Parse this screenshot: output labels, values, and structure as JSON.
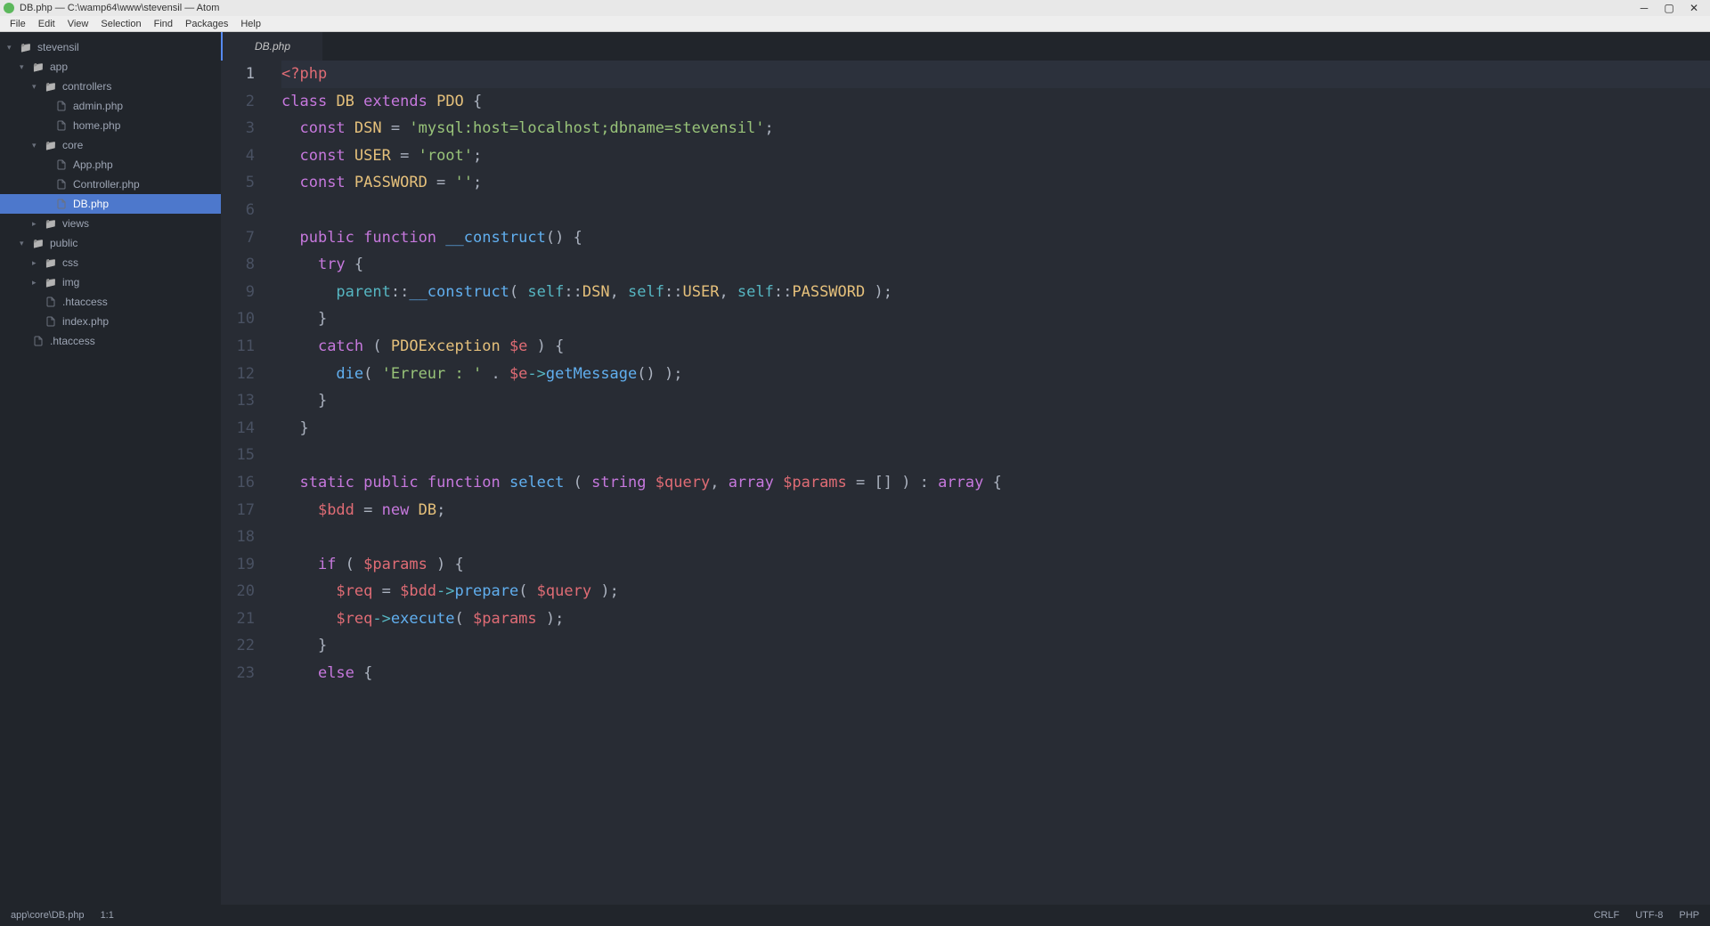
{
  "window": {
    "title": "DB.php — C:\\wamp64\\www\\stevensil — Atom"
  },
  "menu": {
    "items": [
      "File",
      "Edit",
      "View",
      "Selection",
      "Find",
      "Packages",
      "Help"
    ]
  },
  "sidebar": {
    "items": [
      {
        "label": "stevensil",
        "indent": 8,
        "type": "folder",
        "toggle": "▾"
      },
      {
        "label": "app",
        "indent": 22,
        "type": "folder",
        "toggle": "▾"
      },
      {
        "label": "controllers",
        "indent": 36,
        "type": "folder",
        "toggle": "▾"
      },
      {
        "label": "admin.php",
        "indent": 62,
        "type": "file"
      },
      {
        "label": "home.php",
        "indent": 62,
        "type": "file"
      },
      {
        "label": "core",
        "indent": 36,
        "type": "folder",
        "toggle": "▾"
      },
      {
        "label": "App.php",
        "indent": 62,
        "type": "file"
      },
      {
        "label": "Controller.php",
        "indent": 62,
        "type": "file"
      },
      {
        "label": "DB.php",
        "indent": 62,
        "type": "file",
        "selected": true
      },
      {
        "label": "views",
        "indent": 36,
        "type": "folder",
        "toggle": "▸"
      },
      {
        "label": "public",
        "indent": 22,
        "type": "folder",
        "toggle": "▾"
      },
      {
        "label": "css",
        "indent": 36,
        "type": "folder",
        "toggle": "▸"
      },
      {
        "label": "img",
        "indent": 36,
        "type": "folder",
        "toggle": "▸"
      },
      {
        "label": ".htaccess",
        "indent": 50,
        "type": "file"
      },
      {
        "label": "index.php",
        "indent": 50,
        "type": "file"
      },
      {
        "label": ".htaccess",
        "indent": 36,
        "type": "file"
      }
    ]
  },
  "tabs": {
    "active": "DB.php"
  },
  "editor": {
    "cursor": "1:1",
    "lines": [
      {
        "n": 1,
        "active": true,
        "tokens": [
          [
            "tag",
            "<?php"
          ]
        ]
      },
      {
        "n": 2,
        "tokens": [
          [
            "kw",
            "class"
          ],
          [
            "punc",
            " "
          ],
          [
            "cls",
            "DB"
          ],
          [
            "punc",
            " "
          ],
          [
            "kw",
            "extends"
          ],
          [
            "punc",
            " "
          ],
          [
            "cls",
            "PDO"
          ],
          [
            "punc",
            " {"
          ]
        ]
      },
      {
        "n": 3,
        "tokens": [
          [
            "punc",
            "  "
          ],
          [
            "kw",
            "const"
          ],
          [
            "punc",
            " "
          ],
          [
            "const-name",
            "DSN"
          ],
          [
            "punc",
            " = "
          ],
          [
            "str",
            "'mysql:host=localhost;dbname=stevensil'"
          ],
          [
            "punc",
            ";"
          ]
        ]
      },
      {
        "n": 4,
        "tokens": [
          [
            "punc",
            "  "
          ],
          [
            "kw",
            "const"
          ],
          [
            "punc",
            " "
          ],
          [
            "const-name",
            "USER"
          ],
          [
            "punc",
            " = "
          ],
          [
            "str",
            "'root'"
          ],
          [
            "punc",
            ";"
          ]
        ]
      },
      {
        "n": 5,
        "tokens": [
          [
            "punc",
            "  "
          ],
          [
            "kw",
            "const"
          ],
          [
            "punc",
            " "
          ],
          [
            "const-name",
            "PASSWORD"
          ],
          [
            "punc",
            " = "
          ],
          [
            "str",
            "''"
          ],
          [
            "punc",
            ";"
          ]
        ]
      },
      {
        "n": 6,
        "tokens": []
      },
      {
        "n": 7,
        "tokens": [
          [
            "punc",
            "  "
          ],
          [
            "kw",
            "public"
          ],
          [
            "punc",
            " "
          ],
          [
            "kw",
            "function"
          ],
          [
            "punc",
            " "
          ],
          [
            "fn",
            "__construct"
          ],
          [
            "punc",
            "() {"
          ]
        ]
      },
      {
        "n": 8,
        "tokens": [
          [
            "punc",
            "    "
          ],
          [
            "kw",
            "try"
          ],
          [
            "punc",
            " {"
          ]
        ]
      },
      {
        "n": 9,
        "tokens": [
          [
            "punc",
            "      "
          ],
          [
            "builtin",
            "parent"
          ],
          [
            "punc",
            "::"
          ],
          [
            "fn",
            "__construct"
          ],
          [
            "punc",
            "( "
          ],
          [
            "builtin",
            "self"
          ],
          [
            "punc",
            "::"
          ],
          [
            "const-name",
            "DSN"
          ],
          [
            "punc",
            ", "
          ],
          [
            "builtin",
            "self"
          ],
          [
            "punc",
            "::"
          ],
          [
            "const-name",
            "USER"
          ],
          [
            "punc",
            ", "
          ],
          [
            "builtin",
            "self"
          ],
          [
            "punc",
            "::"
          ],
          [
            "const-name",
            "PASSWORD"
          ],
          [
            "punc",
            " );"
          ]
        ]
      },
      {
        "n": 10,
        "tokens": [
          [
            "punc",
            "    }"
          ]
        ]
      },
      {
        "n": 11,
        "tokens": [
          [
            "punc",
            "    "
          ],
          [
            "kw",
            "catch"
          ],
          [
            "punc",
            " ( "
          ],
          [
            "cls",
            "PDOException"
          ],
          [
            "punc",
            " "
          ],
          [
            "var",
            "$e"
          ],
          [
            "punc",
            " ) {"
          ]
        ]
      },
      {
        "n": 12,
        "tokens": [
          [
            "punc",
            "      "
          ],
          [
            "fn",
            "die"
          ],
          [
            "punc",
            "( "
          ],
          [
            "str",
            "'Erreur : '"
          ],
          [
            "punc",
            " . "
          ],
          [
            "var",
            "$e"
          ],
          [
            "op",
            "->"
          ],
          [
            "fn",
            "getMessage"
          ],
          [
            "punc",
            "() );"
          ]
        ]
      },
      {
        "n": 13,
        "tokens": [
          [
            "punc",
            "    }"
          ]
        ]
      },
      {
        "n": 14,
        "tokens": [
          [
            "punc",
            "  }"
          ]
        ]
      },
      {
        "n": 15,
        "tokens": []
      },
      {
        "n": 16,
        "tokens": [
          [
            "punc",
            "  "
          ],
          [
            "kw",
            "static"
          ],
          [
            "punc",
            " "
          ],
          [
            "kw",
            "public"
          ],
          [
            "punc",
            " "
          ],
          [
            "kw",
            "function"
          ],
          [
            "punc",
            " "
          ],
          [
            "fn",
            "select"
          ],
          [
            "punc",
            " ( "
          ],
          [
            "kw",
            "string"
          ],
          [
            "punc",
            " "
          ],
          [
            "var",
            "$query"
          ],
          [
            "punc",
            ", "
          ],
          [
            "kw",
            "array"
          ],
          [
            "punc",
            " "
          ],
          [
            "var",
            "$params"
          ],
          [
            "punc",
            " = [] ) : "
          ],
          [
            "kw",
            "array"
          ],
          [
            "punc",
            " {"
          ]
        ]
      },
      {
        "n": 17,
        "tokens": [
          [
            "punc",
            "    "
          ],
          [
            "var",
            "$bdd"
          ],
          [
            "punc",
            " = "
          ],
          [
            "kw",
            "new"
          ],
          [
            "punc",
            " "
          ],
          [
            "cls",
            "DB"
          ],
          [
            "punc",
            ";"
          ]
        ]
      },
      {
        "n": 18,
        "tokens": []
      },
      {
        "n": 19,
        "tokens": [
          [
            "punc",
            "    "
          ],
          [
            "kw",
            "if"
          ],
          [
            "punc",
            " ( "
          ],
          [
            "var",
            "$params"
          ],
          [
            "punc",
            " ) {"
          ]
        ]
      },
      {
        "n": 20,
        "tokens": [
          [
            "punc",
            "      "
          ],
          [
            "var",
            "$req"
          ],
          [
            "punc",
            " = "
          ],
          [
            "var",
            "$bdd"
          ],
          [
            "op",
            "->"
          ],
          [
            "fn",
            "prepare"
          ],
          [
            "punc",
            "( "
          ],
          [
            "var",
            "$query"
          ],
          [
            "punc",
            " );"
          ]
        ]
      },
      {
        "n": 21,
        "tokens": [
          [
            "punc",
            "      "
          ],
          [
            "var",
            "$req"
          ],
          [
            "op",
            "->"
          ],
          [
            "fn",
            "execute"
          ],
          [
            "punc",
            "( "
          ],
          [
            "var",
            "$params"
          ],
          [
            "punc",
            " );"
          ]
        ]
      },
      {
        "n": 22,
        "tokens": [
          [
            "punc",
            "    }"
          ]
        ]
      },
      {
        "n": 23,
        "tokens": [
          [
            "punc",
            "    "
          ],
          [
            "kw",
            "else"
          ],
          [
            "punc",
            " {"
          ]
        ]
      }
    ]
  },
  "status": {
    "path": "app\\core\\DB.php",
    "pos": "1:1",
    "eol": "CRLF",
    "encoding": "UTF-8",
    "lang": "PHP"
  }
}
